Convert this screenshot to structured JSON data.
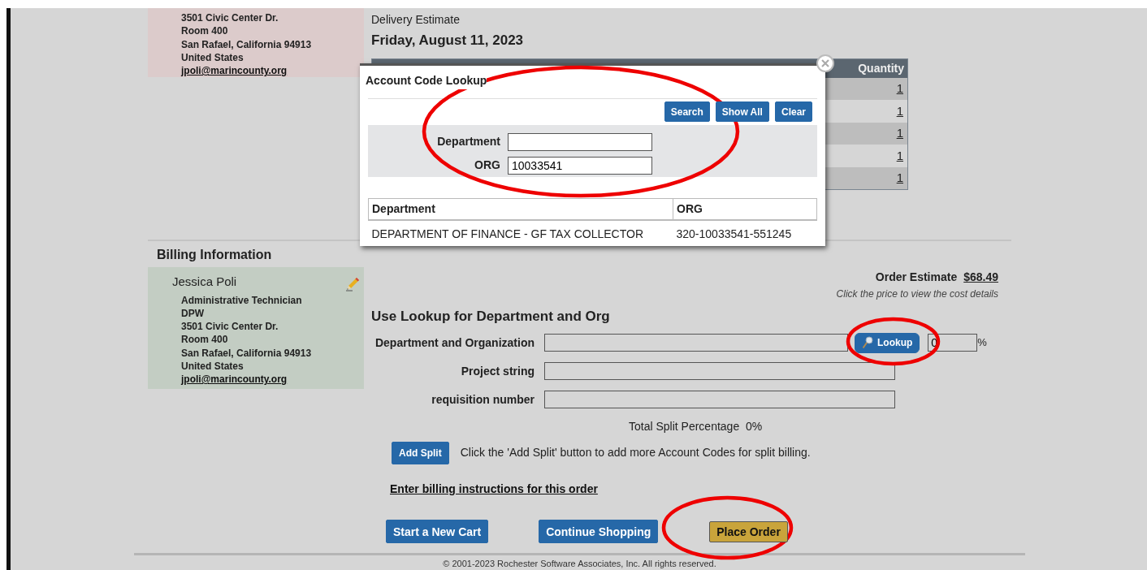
{
  "shipping_card": {
    "lines": [
      "3501 Civic Center Dr.",
      "Room 400",
      "San Rafael, California 94913",
      "United States"
    ],
    "email": "jpoli@marincounty.org"
  },
  "delivery": {
    "label": "Delivery Estimate",
    "date": "Friday, August 11, 2023"
  },
  "ordered_items": {
    "columns": [
      "Quantity"
    ],
    "rows": [
      {
        "quantity": "1"
      },
      {
        "quantity": "1"
      },
      {
        "quantity": "1"
      },
      {
        "quantity": "1"
      },
      {
        "quantity": "1"
      }
    ]
  },
  "billing": {
    "title": "Billing Information",
    "name": "Jessica Poli",
    "lines": [
      "Administrative Technician",
      "DPW",
      "3501 Civic Center Dr.",
      "Room 400",
      "San Rafael, California 94913",
      "United States"
    ],
    "email": "jpoli@marincounty.org"
  },
  "order_estimate": {
    "label": "Order Estimate",
    "price": "$68.49",
    "hint": "Click the price to view the cost details"
  },
  "lookup_section": {
    "title": "Use Lookup for Department and Org",
    "fields": [
      {
        "label": "Department and Organization",
        "kind": "lookup",
        "button": "Lookup",
        "percent": "0",
        "percent_unit": "%"
      },
      {
        "label": "Project string",
        "kind": "text"
      },
      {
        "label": "requisition number",
        "kind": "text"
      }
    ]
  },
  "split": {
    "total_label": "Total Split Percentage",
    "total": "0%",
    "button": "Add Split",
    "hint": "Click the 'Add Split' button to add more Account Codes for split billing."
  },
  "billing_instructions_link": "Enter billing instructions for this order",
  "actions": [
    {
      "label": "Start a New Cart",
      "kind": "secondary"
    },
    {
      "label": "Continue Shopping",
      "kind": "secondary"
    },
    {
      "label": "Place Order",
      "kind": "primary"
    }
  ],
  "footer": "© 2001-2023 Rochester Software Associates, Inc. All rights reserved.",
  "modal": {
    "title": "Account Code Lookup",
    "buttons": [
      "Search",
      "Show All",
      "Clear"
    ],
    "fields": [
      {
        "label": "Department"
      },
      {
        "label": "ORG",
        "value": "10033541"
      }
    ],
    "results": {
      "columns": [
        "Department",
        "ORG"
      ],
      "rows": [
        [
          "DEPARTMENT OF FINANCE - GF TAX COLLECTOR",
          "320-10033541-551245"
        ]
      ]
    }
  }
}
